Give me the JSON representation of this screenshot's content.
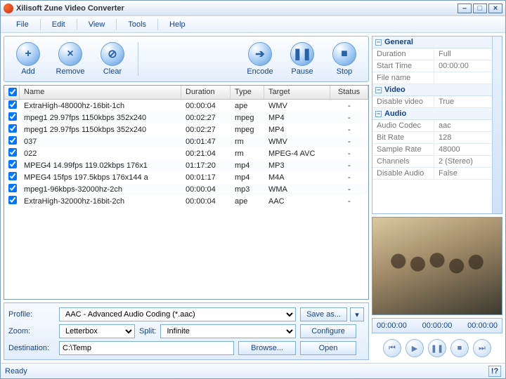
{
  "app": {
    "title": "Xilisoft Zune Video Converter"
  },
  "menu": [
    "File",
    "Edit",
    "View",
    "Tools",
    "Help"
  ],
  "toolbar": {
    "groups": [
      [
        {
          "id": "add",
          "label": "Add",
          "glyph": "+"
        },
        {
          "id": "remove",
          "label": "Remove",
          "glyph": "×"
        },
        {
          "id": "clear",
          "label": "Clear",
          "glyph": "⊘"
        }
      ],
      [
        {
          "id": "encode",
          "label": "Encode",
          "glyph": "➔"
        },
        {
          "id": "pause",
          "label": "Pause",
          "glyph": "❚❚"
        },
        {
          "id": "stop",
          "label": "Stop",
          "glyph": "■"
        }
      ]
    ]
  },
  "list": {
    "headers": [
      "",
      "Name",
      "Duration",
      "Type",
      "Target",
      "Status"
    ],
    "rows": [
      {
        "chk": true,
        "name": "ExtraHigh-48000hz-16bit-1ch",
        "dur": "00:00:04",
        "type": "ape",
        "target": "WMV",
        "status": "-"
      },
      {
        "chk": true,
        "name": "mpeg1 29.97fps 1150kbps 352x240",
        "dur": "00:02:27",
        "type": "mpeg",
        "target": "MP4",
        "status": "-"
      },
      {
        "chk": true,
        "name": "mpeg1 29.97fps 1150kbps 352x240",
        "dur": "00:02:27",
        "type": "mpeg",
        "target": "MP4",
        "status": "-"
      },
      {
        "chk": true,
        "name": "037",
        "dur": "00:01:47",
        "type": "rm",
        "target": "WMV",
        "status": "-"
      },
      {
        "chk": true,
        "name": "022",
        "dur": "00:21:04",
        "type": "rm",
        "target": "MPEG-4 AVC",
        "status": "-"
      },
      {
        "chk": true,
        "name": "MPEG4 14.99fps 119.02kbps 176x1",
        "dur": "01:17:20",
        "type": "mp4",
        "target": "MP3",
        "status": "-"
      },
      {
        "chk": true,
        "name": "MPEG4 15fps 197.5kbps 176x144 a",
        "dur": "00:01:17",
        "type": "mp4",
        "target": "M4A",
        "status": "-"
      },
      {
        "chk": true,
        "name": "mpeg1-96kbps-32000hz-2ch",
        "dur": "00:00:04",
        "type": "mp3",
        "target": "WMA",
        "status": "-"
      },
      {
        "chk": true,
        "name": "ExtraHigh-32000hz-16bit-2ch",
        "dur": "00:00:04",
        "type": "ape",
        "target": "AAC",
        "status": "-"
      }
    ]
  },
  "props": [
    {
      "group": "General",
      "rows": [
        [
          "Duration",
          "Full"
        ],
        [
          "Start Time",
          "00:00:00"
        ],
        [
          "File name",
          ""
        ]
      ]
    },
    {
      "group": "Video",
      "rows": [
        [
          "Disable video",
          "True"
        ]
      ]
    },
    {
      "group": "Audio",
      "rows": [
        [
          "Audio Codec",
          "aac"
        ],
        [
          "Bit Rate",
          "128"
        ],
        [
          "Sample Rate",
          "48000"
        ],
        [
          "Channels",
          "2 (Stereo)"
        ],
        [
          "Disable Audio",
          "False"
        ]
      ]
    }
  ],
  "bottom": {
    "profile_label": "Profile:",
    "profile_value": "AAC - Advanced Audio Coding  (*.aac)",
    "saveas": "Save as...",
    "zoom_label": "Zoom:",
    "zoom_value": "Letterbox",
    "split_label": "Split:",
    "split_value": "Infinite",
    "configure": "Configure",
    "dest_label": "Destination:",
    "dest_value": "C:\\Temp",
    "browse": "Browse...",
    "open": "Open"
  },
  "timeline": {
    "t1": "00:00:00",
    "t2": "00:00:00",
    "t3": "00:00:00"
  },
  "playctrl": [
    "⏮",
    "▶",
    "❚❚",
    "■",
    "⏭"
  ],
  "status": {
    "ready": "Ready",
    "help": "!?"
  }
}
